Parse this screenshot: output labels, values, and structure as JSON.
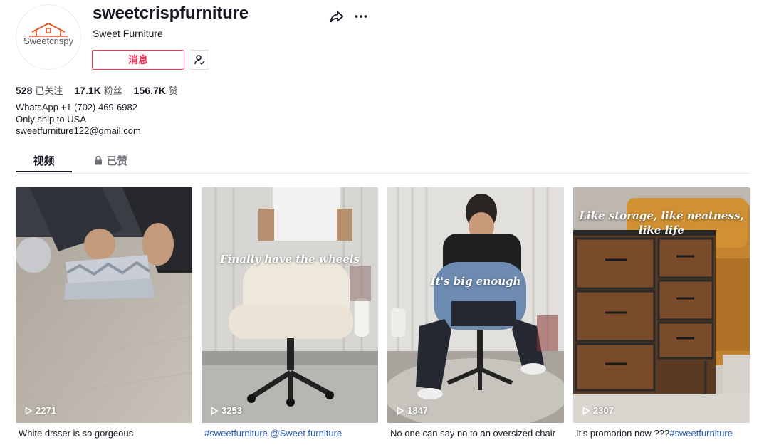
{
  "profile": {
    "username": "sweetcrispfurniture",
    "nickname": "Sweet Furniture",
    "avatar_logo_text": "Sweetcrispy",
    "message_label": "消息",
    "share_icon": "share-icon",
    "more_icon": "more-icon"
  },
  "stats": [
    {
      "value": "528",
      "label": "已关注"
    },
    {
      "value": "17.1K",
      "label": "粉丝"
    },
    {
      "value": "156.7K",
      "label": "赞"
    }
  ],
  "bio": [
    "WhatsApp +1 (702) 469-6982",
    "Only ship to USA",
    "sweetfurniture122@gmail.com"
  ],
  "tabs": [
    {
      "label": "视频",
      "active": true
    },
    {
      "label": "已赞",
      "active": false,
      "icon": "lock-icon"
    }
  ],
  "videos": [
    {
      "views": "2271",
      "overlay": "",
      "caption": "White drsser is so gorgeous",
      "caption_tags": ""
    },
    {
      "views": "3253",
      "overlay": "Finally have the wheels",
      "caption": "",
      "caption_tags": "#sweetfurniture @Sweet furniture"
    },
    {
      "views": "1847",
      "overlay": "It's big enough",
      "caption": "No one can say no to an oversized chair",
      "caption_tags": ""
    },
    {
      "views": "2307",
      "overlay": "Like storage, like neatness, like life",
      "caption": "It's promorion now ???",
      "caption_tags": "#sweetfurniture"
    }
  ],
  "colors": {
    "accent": "#fe2c55",
    "hashtag": "#2b5db9"
  }
}
